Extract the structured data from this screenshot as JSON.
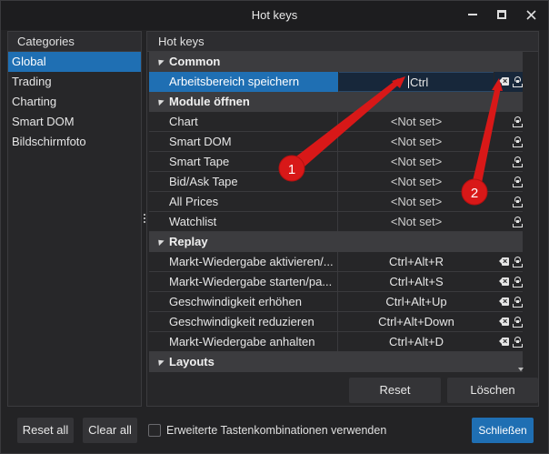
{
  "window": {
    "title": "Hot keys",
    "controls": {
      "minimize": "minimize-icon",
      "maximize": "maximize-icon",
      "close": "close-icon"
    }
  },
  "categories": {
    "header": "Categories",
    "items": [
      {
        "label": "Global",
        "selected": true
      },
      {
        "label": "Trading"
      },
      {
        "label": "Charting"
      },
      {
        "label": "Smart DOM"
      },
      {
        "label": "Bildschirmfoto"
      }
    ]
  },
  "hotkeys": {
    "header": "Hot keys",
    "groups": [
      {
        "title": "Common",
        "rows": [
          {
            "name": "Arbeitsbereich speichern",
            "key": "Ctrl",
            "selected": true
          }
        ]
      },
      {
        "title": "Module öffnen",
        "rows": [
          {
            "name": "Chart",
            "key": "<Not set>"
          },
          {
            "name": "Smart DOM",
            "key": "<Not set>"
          },
          {
            "name": "Smart Tape",
            "key": "<Not set>"
          },
          {
            "name": "Bid/Ask Tape",
            "key": "<Not set>"
          },
          {
            "name": "All Prices",
            "key": "<Not set>"
          },
          {
            "name": "Watchlist",
            "key": "<Not set>"
          }
        ]
      },
      {
        "title": "Replay",
        "rows": [
          {
            "name": "Markt-Wiedergabe aktivieren/...",
            "key": "Ctrl+Alt+R"
          },
          {
            "name": "Markt-Wiedergabe starten/pa...",
            "key": "Ctrl+Alt+S"
          },
          {
            "name": "Geschwindigkeit erhöhen",
            "key": "Ctrl+Alt+Up"
          },
          {
            "name": "Geschwindigkeit reduzieren",
            "key": "Ctrl+Alt+Down"
          },
          {
            "name": "Markt-Wiedergabe anhalten",
            "key": "Ctrl+Alt+D"
          }
        ]
      },
      {
        "title": "Layouts",
        "rows": []
      }
    ],
    "row_icons": {
      "clear": "clear-key-icon",
      "reset": "reset-key-icon"
    }
  },
  "buttons": {
    "reset": "Reset",
    "delete": "Löschen",
    "reset_all": "Reset all",
    "clear_all": "Clear all",
    "close": "Schließen"
  },
  "options": {
    "extended_combinations": {
      "label": "Erweiterte Tastenkombinationen verwenden",
      "checked": false
    }
  },
  "annotations": [
    {
      "label": "1"
    },
    {
      "label": "2"
    }
  ],
  "colors": {
    "accent": "#1f6fb3",
    "annotation_red": "#d81818",
    "background": "#232325"
  }
}
